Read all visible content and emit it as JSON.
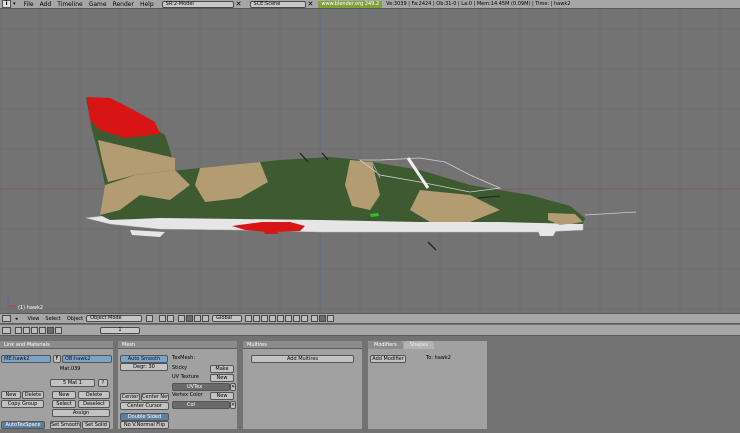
{
  "topbar": {
    "menus": [
      "File",
      "Add",
      "Timeline",
      "Game",
      "Render",
      "Help"
    ],
    "screen_field": "SR:2-Model",
    "scene_field": "SCE:Scene",
    "url": "www.blender.org 249.2",
    "stats": "Ve:3039 | Fa:2424 | Ob:31-0 | La:0 | Mem:14.45M (0.09M) | Time: | hawk2"
  },
  "viewport": {
    "object_label": "(1) hawk2",
    "colors": {
      "background": "#737373",
      "grid": "#6a6a6a",
      "dark_green": "#3d5a31",
      "tan": "#b39b72",
      "red": "#d91414",
      "white": "#e6e6e6"
    }
  },
  "view3d_header": {
    "menus": [
      "View",
      "Select",
      "Object"
    ],
    "mode": "Object Mode",
    "orientation": "Global"
  },
  "buttons_header": {
    "frame": "1"
  },
  "link_materials": {
    "title": "Link and Materials",
    "me_field": "ME:hawk2",
    "f_label": "F",
    "ob_field": "OB:hawk2",
    "mat_name": "Mat.039",
    "mat_slot": "5 Mat 1",
    "question": "?",
    "new_left": "New",
    "delete_left": "Delete",
    "copy_group": "Copy Group",
    "new_right": "New",
    "delete_right": "Delete",
    "select": "Select",
    "deselect": "Deselect",
    "assign": "Assign",
    "auto_tex_space": "AutoTexSpace",
    "set_smooth": "Set Smooth",
    "set_solid": "Set Solid"
  },
  "mesh": {
    "title": "Mesh",
    "auto_smooth": "Auto Smooth",
    "degr": "Degr: 30",
    "tex_mesh": "TexMesh:",
    "sticky": "Sticky",
    "make": "Make",
    "uv_texture": "UV Texture",
    "uv_new": "New",
    "uv_name": "UVTex",
    "vertex_color": "Vertex Color",
    "vc_new": "New",
    "vc_name": "Col",
    "center": "Center",
    "center_new": "Center New",
    "center_cursor": "Center Cursor",
    "double_sided": "Double Sided",
    "no_vnormal_flip": "No V.Normal Flip"
  },
  "multires": {
    "title": "Multires",
    "add_multires": "Add Multires"
  },
  "modifiers": {
    "tab_modifiers": "Modifiers",
    "tab_shapes": "Shapes",
    "add_modifier": "Add Modifier",
    "to_label": "To: hawk2"
  }
}
